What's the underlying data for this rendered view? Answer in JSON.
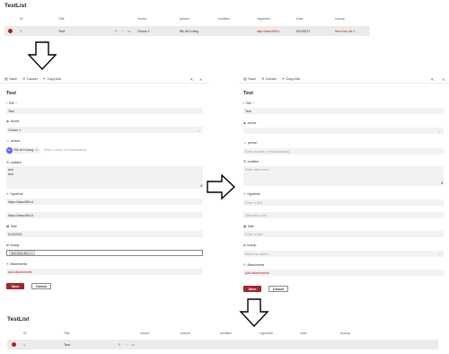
{
  "list_title": "TestList",
  "columns": [
    "ID",
    "Title",
    "choice",
    "person",
    "multiline",
    "Hyperlink",
    "Date",
    "lookup"
  ],
  "top_row": {
    "id": "1",
    "title": "Test",
    "choice": "Choice 1",
    "person": "Rik de Koning",
    "hyperlink": "https://akso365.nl",
    "date": "5/10/2021",
    "lookup": "Item from list 1"
  },
  "bottom_row": {
    "id": "1",
    "title": "Test"
  },
  "toolbar": {
    "save": "Save",
    "cancel": "Cancel",
    "copy_link": "Copy link"
  },
  "left_form": {
    "heading": "Test",
    "title_label": "Title",
    "title_value": "Test",
    "choice_label": "choice",
    "choice_value": "Choice 1",
    "person_label": "person",
    "person_initials": "RK",
    "person_name": "Rik de Koning",
    "person_placeholder": "Enter a name or email address",
    "multiline_label": "multiline",
    "multiline_line1": "test",
    "multiline_line2": "test",
    "hyperlink_label": "Hyperlink",
    "hyperlink_url": "https://akso365.nl",
    "hyperlink_alt": "https://akso365.nl",
    "date_label": "Date",
    "date_value": "5/10/2021",
    "lookup_label": "lookup",
    "lookup_value": "Item from list 1",
    "attachments_label": "Attachments",
    "add_attachments": "Add attachments",
    "save": "Save",
    "cancel": "Cancel"
  },
  "right_form": {
    "heading": "Test",
    "title_label": "Title",
    "title_value": "Test",
    "choice_label": "choice",
    "person_label": "person",
    "person_placeholder": "Enter a name or email address",
    "multiline_label": "multiline",
    "multiline_placeholder": "Enter value here",
    "hyperlink_label": "Hyperlink",
    "hyperlink_placeholder": "Enter a URL",
    "hyperlink_alt_placeholder": "Alternative text",
    "date_label": "Date",
    "date_placeholder": "Enter a date",
    "lookup_label": "lookup",
    "lookup_placeholder": "Select an option",
    "attachments_label": "Attachments",
    "add_attachments": "Add attachments",
    "save": "Save",
    "cancel": "Cancel"
  },
  "colors": {
    "accent": "#a4262c",
    "field_bg": "#f3f2f1",
    "row_bg": "#edebe9"
  }
}
